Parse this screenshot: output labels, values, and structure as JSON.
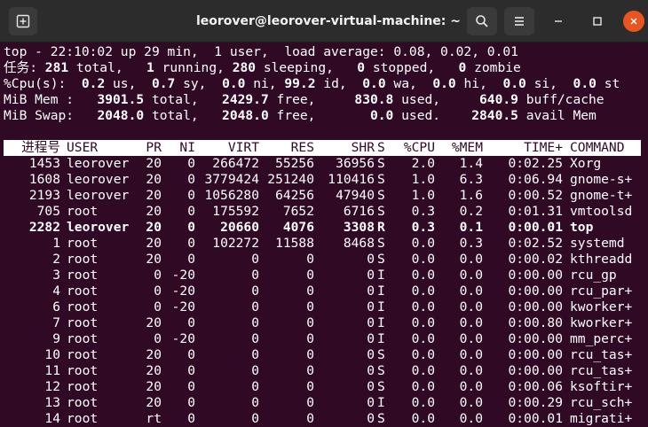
{
  "window": {
    "title": "leorover@leorover-virtual-machine: ~",
    "icons": [
      "new-tab-icon",
      "search-icon",
      "hamburger-menu-icon",
      "minimize-icon",
      "maximize-icon",
      "close-icon"
    ]
  },
  "summary": {
    "top": {
      "prefix": "top - ",
      "time": "22:10:02",
      "up_label": " up ",
      "uptime": "29 min",
      "users_sep": ",  ",
      "users": "1 user",
      "load_label": ",  load average: ",
      "load": "0.08, 0.02, 0.01"
    },
    "tasks": {
      "label": "任务:",
      "total": "281",
      "total_label": " total,",
      "running": "1",
      "running_label": " running,",
      "sleeping": "280",
      "sleeping_label": " sleeping,",
      "stopped": "0",
      "stopped_label": " stopped,",
      "zombie": "0",
      "zombie_label": " zombie"
    },
    "cpu": {
      "label": "%Cpu(s):",
      "us": "0.2",
      "us_label": " us,",
      "sy": "0.7",
      "sy_label": " sy,",
      "ni": "0.0",
      "ni_label": " ni,",
      "id": "99.2",
      "id_label": " id,",
      "wa": "0.0",
      "wa_label": " wa,",
      "hi": "0.0",
      "hi_label": " hi,",
      "si": "0.0",
      "si_label": " si,",
      "st": "0.0",
      "st_label": " st"
    },
    "mem": {
      "label": "MiB Mem :",
      "total": "3901.5",
      "total_label": " total,",
      "free": "2429.7",
      "free_label": " free,",
      "used": "830.8",
      "used_label": " used,",
      "buff": "640.9",
      "buff_label": " buff/cache"
    },
    "swap": {
      "label": "MiB Swap:",
      "total": "2048.0",
      "total_label": " total,",
      "free": "2048.0",
      "free_label": " free,",
      "used": "0.0",
      "used_label": " used.",
      "avail": "2840.5",
      "avail_label": " avail Mem"
    }
  },
  "columns": [
    "进程号",
    "USER",
    "PR",
    "NI",
    "VIRT",
    "RES",
    "SHR",
    "S",
    "%CPU",
    "%MEM",
    "TIME+",
    "COMMAND"
  ],
  "processes": [
    {
      "pid": "1453",
      "user": "leorover",
      "pr": "20",
      "ni": "0",
      "virt": "266472",
      "res": "55256",
      "shr": "36956",
      "s": "S",
      "cpu": "2.0",
      "mem": "1.4",
      "time": "0:02.25",
      "cmd": "Xorg",
      "bold": false
    },
    {
      "pid": "1608",
      "user": "leorover",
      "pr": "20",
      "ni": "0",
      "virt": "3779424",
      "res": "251240",
      "shr": "110416",
      "s": "S",
      "cpu": "1.0",
      "mem": "6.3",
      "time": "0:06.94",
      "cmd": "gnome-s+",
      "bold": false
    },
    {
      "pid": "2193",
      "user": "leorover",
      "pr": "20",
      "ni": "0",
      "virt": "1056280",
      "res": "64256",
      "shr": "47940",
      "s": "S",
      "cpu": "1.0",
      "mem": "1.6",
      "time": "0:00.52",
      "cmd": "gnome-t+",
      "bold": false
    },
    {
      "pid": "705",
      "user": "root",
      "pr": "20",
      "ni": "0",
      "virt": "175592",
      "res": "7652",
      "shr": "6716",
      "s": "S",
      "cpu": "0.3",
      "mem": "0.2",
      "time": "0:01.31",
      "cmd": "vmtoolsd",
      "bold": false
    },
    {
      "pid": "2282",
      "user": "leorover",
      "pr": "20",
      "ni": "0",
      "virt": "20660",
      "res": "4076",
      "shr": "3308",
      "s": "R",
      "cpu": "0.3",
      "mem": "0.1",
      "time": "0:00.01",
      "cmd": "top",
      "bold": true
    },
    {
      "pid": "1",
      "user": "root",
      "pr": "20",
      "ni": "0",
      "virt": "102272",
      "res": "11588",
      "shr": "8468",
      "s": "S",
      "cpu": "0.0",
      "mem": "0.3",
      "time": "0:02.52",
      "cmd": "systemd",
      "bold": false
    },
    {
      "pid": "2",
      "user": "root",
      "pr": "20",
      "ni": "0",
      "virt": "0",
      "res": "0",
      "shr": "0",
      "s": "S",
      "cpu": "0.0",
      "mem": "0.0",
      "time": "0:00.02",
      "cmd": "kthreadd",
      "bold": false
    },
    {
      "pid": "3",
      "user": "root",
      "pr": "0",
      "ni": "-20",
      "virt": "0",
      "res": "0",
      "shr": "0",
      "s": "I",
      "cpu": "0.0",
      "mem": "0.0",
      "time": "0:00.00",
      "cmd": "rcu_gp",
      "bold": false
    },
    {
      "pid": "4",
      "user": "root",
      "pr": "0",
      "ni": "-20",
      "virt": "0",
      "res": "0",
      "shr": "0",
      "s": "I",
      "cpu": "0.0",
      "mem": "0.0",
      "time": "0:00.00",
      "cmd": "rcu_par+",
      "bold": false
    },
    {
      "pid": "6",
      "user": "root",
      "pr": "0",
      "ni": "-20",
      "virt": "0",
      "res": "0",
      "shr": "0",
      "s": "I",
      "cpu": "0.0",
      "mem": "0.0",
      "time": "0:00.00",
      "cmd": "kworker+",
      "bold": false
    },
    {
      "pid": "7",
      "user": "root",
      "pr": "20",
      "ni": "0",
      "virt": "0",
      "res": "0",
      "shr": "0",
      "s": "I",
      "cpu": "0.0",
      "mem": "0.0",
      "time": "0:00.80",
      "cmd": "kworker+",
      "bold": false
    },
    {
      "pid": "9",
      "user": "root",
      "pr": "0",
      "ni": "-20",
      "virt": "0",
      "res": "0",
      "shr": "0",
      "s": "I",
      "cpu": "0.0",
      "mem": "0.0",
      "time": "0:00.00",
      "cmd": "mm_perc+",
      "bold": false
    },
    {
      "pid": "10",
      "user": "root",
      "pr": "20",
      "ni": "0",
      "virt": "0",
      "res": "0",
      "shr": "0",
      "s": "S",
      "cpu": "0.0",
      "mem": "0.0",
      "time": "0:00.00",
      "cmd": "rcu_tas+",
      "bold": false
    },
    {
      "pid": "11",
      "user": "root",
      "pr": "20",
      "ni": "0",
      "virt": "0",
      "res": "0",
      "shr": "0",
      "s": "S",
      "cpu": "0.0",
      "mem": "0.0",
      "time": "0:00.00",
      "cmd": "rcu_tas+",
      "bold": false
    },
    {
      "pid": "12",
      "user": "root",
      "pr": "20",
      "ni": "0",
      "virt": "0",
      "res": "0",
      "shr": "0",
      "s": "S",
      "cpu": "0.0",
      "mem": "0.0",
      "time": "0:00.06",
      "cmd": "ksoftir+",
      "bold": false
    },
    {
      "pid": "13",
      "user": "root",
      "pr": "20",
      "ni": "0",
      "virt": "0",
      "res": "0",
      "shr": "0",
      "s": "I",
      "cpu": "0.0",
      "mem": "0.0",
      "time": "0:00.29",
      "cmd": "rcu_sch+",
      "bold": false
    },
    {
      "pid": "14",
      "user": "root",
      "pr": "rt",
      "ni": "0",
      "virt": "0",
      "res": "0",
      "shr": "0",
      "s": "S",
      "cpu": "0.0",
      "mem": "0.0",
      "time": "0:00.01",
      "cmd": "migrati+",
      "bold": false
    }
  ],
  "colors": {
    "terminal_bg": "#300a24",
    "titlebar_bg": "#2c2c2c",
    "close_button": "#e95420",
    "text": "#ffffff"
  }
}
